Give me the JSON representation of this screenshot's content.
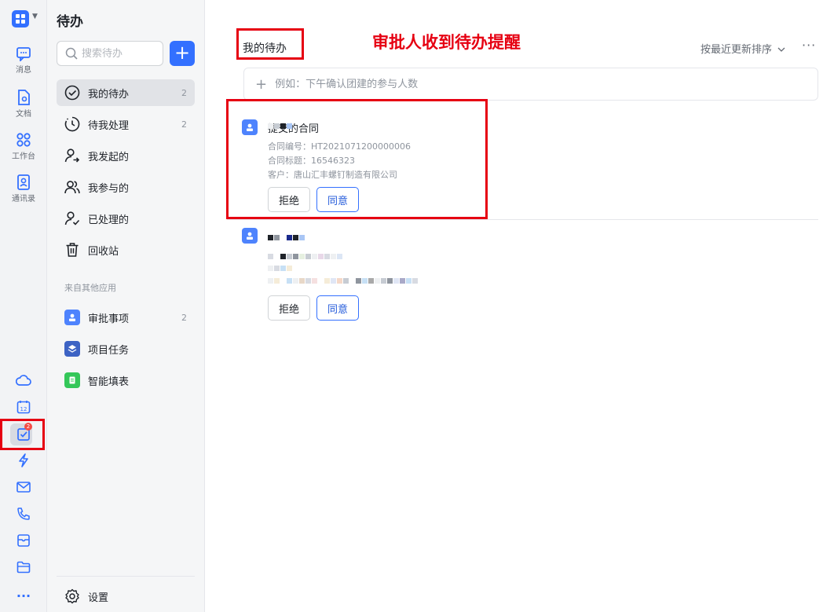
{
  "rail": {
    "items": [
      {
        "label": "消息",
        "icon": "message-icon"
      },
      {
        "label": "文档",
        "icon": "document-icon"
      },
      {
        "label": "工作台",
        "icon": "workbench-icon"
      },
      {
        "label": "通讯录",
        "icon": "contacts-icon"
      }
    ],
    "bottom_icons": [
      "cloud-icon",
      "calendar-icon",
      "todo-icon",
      "lightning-icon",
      "mail-icon",
      "phone-icon",
      "box-icon",
      "folder-icon",
      "more-icon"
    ],
    "calendar_day": "12",
    "todo_badge": "2",
    "more_glyph": "···"
  },
  "sidebar": {
    "title": "待办",
    "search_placeholder": "搜索待办",
    "add_glyph": "+",
    "items": [
      {
        "label": "我的待办",
        "count": "2",
        "icon": "check-circle-icon"
      },
      {
        "label": "待我处理",
        "count": "2",
        "icon": "clock-icon"
      },
      {
        "label": "我发起的",
        "count": "",
        "icon": "user-send-icon"
      },
      {
        "label": "我参与的",
        "count": "",
        "icon": "users-icon"
      },
      {
        "label": "已处理的",
        "count": "",
        "icon": "user-check-icon"
      },
      {
        "label": "回收站",
        "count": "",
        "icon": "trash-icon"
      }
    ],
    "section_label": "来自其他应用",
    "apps": [
      {
        "label": "审批事项",
        "count": "2",
        "icon": "approval-icon",
        "color": "#4e83fd"
      },
      {
        "label": "项目任务",
        "count": "",
        "icon": "project-icon",
        "color": "#3d63c4"
      },
      {
        "label": "智能填表",
        "count": "",
        "icon": "form-icon",
        "color": "#34c759"
      }
    ],
    "settings_label": "设置"
  },
  "main": {
    "title": "我的待办",
    "annotation": "审批人收到待办提醒",
    "sort_label": "按最近更新排序",
    "more_glyph": "···",
    "quick_add_placeholder": "例如：下午确认团建的参与人数",
    "quick_add_glyph": "+",
    "cards": [
      {
        "title_suffix": "提交的合同",
        "lines": [
          "合同编号：HT2021071200000006",
          "合同标题：16546323",
          "客户：唐山汇丰螺钉制造有限公司"
        ],
        "reject_label": "拒绝",
        "approve_label": "同意"
      },
      {
        "reject_label": "拒绝",
        "approve_label": "同意"
      }
    ]
  },
  "colors": {
    "accent": "#3370ff",
    "highlight_red": "#e60012",
    "badge_red": "#f54a45"
  }
}
